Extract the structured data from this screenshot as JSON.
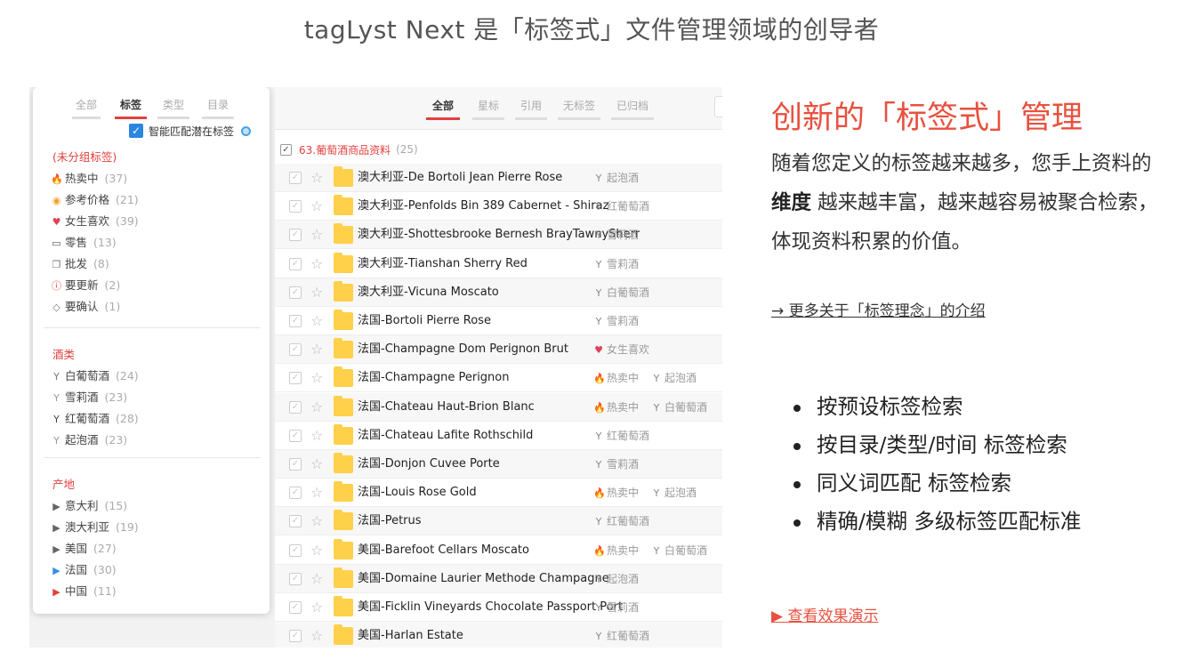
{
  "headline": "tagLyst Next 是「标签式」文件管理领域的创导者",
  "sidebar": {
    "tabs": [
      {
        "label": "全部",
        "active": false
      },
      {
        "label": "标签",
        "active": true
      },
      {
        "label": "类型",
        "active": false
      },
      {
        "label": "目录",
        "active": false
      }
    ],
    "smart_match_label": "智能匹配潜在标签",
    "groups": [
      {
        "title": "(未分组标签)",
        "items": [
          {
            "label": "热卖中",
            "count": "(37)",
            "icon": "flame-icon",
            "color": "#e8513f"
          },
          {
            "label": "参考价格",
            "count": "(21)",
            "icon": "coin-icon",
            "color": "#f0a020"
          },
          {
            "label": "女生喜欢",
            "count": "(39)",
            "icon": "heart-icon",
            "color": "#e0415a"
          },
          {
            "label": "零售",
            "count": "(13)",
            "icon": "cart-icon",
            "color": "#555555"
          },
          {
            "label": "批发",
            "count": "(8)",
            "icon": "copy-icon",
            "color": "#777777"
          },
          {
            "label": "要更新",
            "count": "(2)",
            "icon": "alert-icon",
            "color": "#e0413e"
          },
          {
            "label": "要确认",
            "count": "(1)",
            "icon": "tag-icon",
            "color": "#777777"
          }
        ]
      },
      {
        "title": "酒类",
        "items": [
          {
            "label": "白葡萄酒",
            "count": "(24)",
            "icon": "wineglass-icon",
            "color": "#777777"
          },
          {
            "label": "雪莉酒",
            "count": "(23)",
            "icon": "wineglass-icon",
            "color": "#999999"
          },
          {
            "label": "红葡萄酒",
            "count": "(28)",
            "icon": "wineglass-icon",
            "color": "#444444"
          },
          {
            "label": "起泡酒",
            "count": "(23)",
            "icon": "wineglass-icon",
            "color": "#999999"
          }
        ]
      },
      {
        "title": "产地",
        "items": [
          {
            "label": "意大利",
            "count": "(15)",
            "icon": "flag-icon",
            "color": "#666666"
          },
          {
            "label": "澳大利亚",
            "count": "(19)",
            "icon": "flag-icon",
            "color": "#666666"
          },
          {
            "label": "美国",
            "count": "(27)",
            "icon": "flag-icon",
            "color": "#666666"
          },
          {
            "label": "法国",
            "count": "(30)",
            "icon": "flag-icon",
            "color": "#3a8fe0"
          },
          {
            "label": "中国",
            "count": "(11)",
            "icon": "flag-icon",
            "color": "#e0413e"
          }
        ]
      }
    ]
  },
  "list": {
    "tabs": [
      {
        "label": "全部",
        "active": true
      },
      {
        "label": "星标",
        "active": false
      },
      {
        "label": "引用",
        "active": false
      },
      {
        "label": "无标签",
        "active": false
      },
      {
        "label": "已归档",
        "active": false
      }
    ],
    "folder": {
      "name": "63.葡萄酒商品资料",
      "count": "(25)"
    },
    "rows": [
      {
        "name": "澳大利亚-De Bortoli Jean Pierre Rose",
        "tags": [
          {
            "label": "起泡酒",
            "icon": "wineglass-icon"
          }
        ]
      },
      {
        "name": "澳大利亚-Penfolds Bin 389 Cabernet - Shiraz",
        "tags": [
          {
            "label": "红葡萄酒",
            "icon": "wineglass-icon"
          }
        ]
      },
      {
        "name": "澳大利亚-Shottesbrooke Bernesh BrayTawnySherr",
        "tags": [
          {
            "label": "雪莉酒",
            "icon": "wineglass-icon"
          }
        ]
      },
      {
        "name": "澳大利亚-Tianshan Sherry Red",
        "tags": [
          {
            "label": "雪莉酒",
            "icon": "wineglass-icon"
          }
        ]
      },
      {
        "name": "澳大利亚-Vicuna Moscato",
        "tags": [
          {
            "label": "白葡萄酒",
            "icon": "wineglass-icon"
          }
        ]
      },
      {
        "name": "法国-Bortoli Pierre Rose",
        "tags": [
          {
            "label": "雪莉酒",
            "icon": "wineglass-icon"
          }
        ]
      },
      {
        "name": "法国-Champagne Dom Perignon Brut",
        "tags": [
          {
            "label": "女生喜欢",
            "icon": "heart-icon"
          }
        ]
      },
      {
        "name": "法国-Champagne Perignon",
        "tags": [
          {
            "label": "热卖中",
            "icon": "flame-icon"
          },
          {
            "label": "起泡酒",
            "icon": "wineglass-icon"
          }
        ]
      },
      {
        "name": "法国-Chateau Haut-Brion Blanc",
        "tags": [
          {
            "label": "热卖中",
            "icon": "flame-icon"
          },
          {
            "label": "白葡萄酒",
            "icon": "wineglass-icon"
          }
        ]
      },
      {
        "name": "法国-Chateau Lafite Rothschild",
        "tags": [
          {
            "label": "红葡萄酒",
            "icon": "wineglass-icon"
          }
        ]
      },
      {
        "name": "法国-Donjon Cuvee Porte",
        "tags": [
          {
            "label": "雪莉酒",
            "icon": "wineglass-icon"
          }
        ]
      },
      {
        "name": "法国-Louis Rose Gold",
        "tags": [
          {
            "label": "热卖中",
            "icon": "flame-icon"
          },
          {
            "label": "起泡酒",
            "icon": "wineglass-icon"
          }
        ]
      },
      {
        "name": "法国-Petrus",
        "tags": [
          {
            "label": "红葡萄酒",
            "icon": "wineglass-icon"
          }
        ]
      },
      {
        "name": "美国-Barefoot Cellars Moscato",
        "tags": [
          {
            "label": "热卖中",
            "icon": "flame-icon"
          },
          {
            "label": "白葡萄酒",
            "icon": "wineglass-icon"
          }
        ]
      },
      {
        "name": "美国-Domaine Laurier Methode Champagne",
        "tags": [
          {
            "label": "起泡酒",
            "icon": "wineglass-icon"
          }
        ]
      },
      {
        "name": "美国-Ficklin Vineyards Chocolate Passport Port",
        "tags": [
          {
            "label": "雪莉酒",
            "icon": "wineglass-icon"
          }
        ]
      },
      {
        "name": "美国-Harlan Estate",
        "tags": [
          {
            "label": "红葡萄酒",
            "icon": "wineglass-icon"
          }
        ]
      }
    ]
  },
  "right": {
    "title": "创新的「标签式」管理",
    "para_1": "随着您定义的标签越来越多，您手上资料的 ",
    "para_bold": "维度",
    "para_2": " 越来越丰富，越来越容易被聚合检索，体现资料积累的价值。",
    "more_link": "→ 更多关于「标签理念」的介绍",
    "bullets": [
      "按预设标签检索",
      "按目录/类型/时间 标签检索",
      "同义词匹配 标签检索",
      "精确/模糊 多级标签匹配标准"
    ],
    "demo_link": "▶ 查看效果演示"
  },
  "colors": {
    "accent": "#e8513f",
    "check_blue": "#2a86e0",
    "folder_yellow": "#ffd04a"
  }
}
